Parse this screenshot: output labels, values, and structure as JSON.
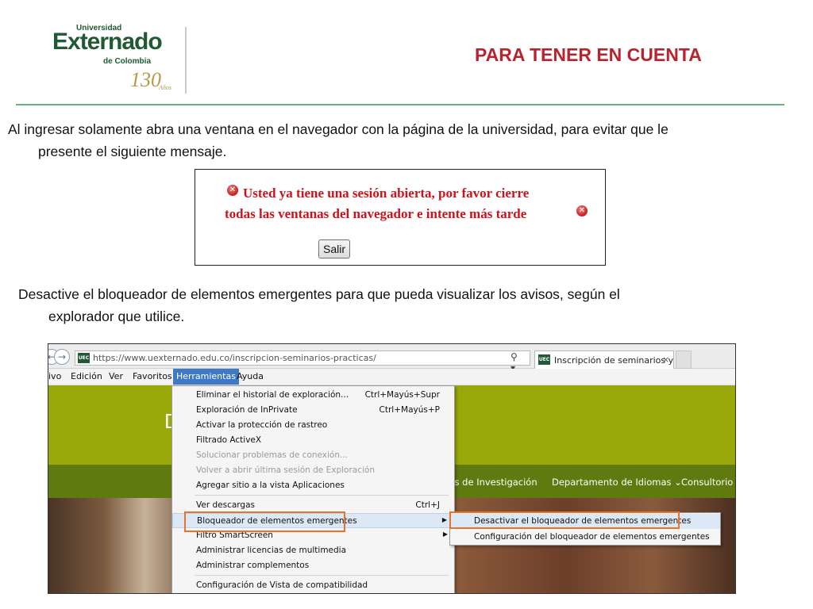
{
  "header": {
    "logo": {
      "universidad": "Universidad",
      "externado": "Externado",
      "de_colombia": "de Colombia",
      "anniversary": "130",
      "anos": "Años"
    },
    "title": "PARA TENER EN CUENTA"
  },
  "paragraph1": {
    "line1": "Al ingresar solamente abra una ventana en el navegador con la página de la universidad, para evitar que le",
    "line2": "presente el siguiente mensaje."
  },
  "warning_dialog": {
    "line1": "Usted ya tiene una sesión abierta, por favor cierre",
    "line2": "todas las ventanas del navegador e intente más tarde",
    "icon": "error-icon",
    "button_label": "Salir"
  },
  "paragraph2": {
    "line1": "Desactive el bloqueador de elementos emergentes para que pueda visualizar los avisos, según el",
    "line2": "explorador que utilice."
  },
  "browser": {
    "favicon_text": "UEC",
    "url": "https://www.uexternado.edu.co/inscripcion-seminarios-practicas/",
    "address_icons": "⚲ ▾ 🔒 ↻",
    "tab_title": "Inscripción de seminarios y ...",
    "tab_close": "×",
    "menu": [
      "ivo",
      "Edición",
      "Ver",
      "Favoritos",
      "Herramientas",
      "Ayuda"
    ],
    "banner_letter": "D",
    "site_nav": [
      "ros de Investigación",
      "Departamento de Idiomas ⌄",
      "Consultorio"
    ],
    "tools_menu": [
      {
        "label": "Eliminar el historial de exploración...",
        "shortcut": "Ctrl+Mayús+Supr",
        "disabled": false
      },
      {
        "label": "Exploración de InPrivate",
        "shortcut": "Ctrl+Mayús+P",
        "disabled": false
      },
      {
        "label": "Activar la protección de rastreo",
        "shortcut": "",
        "disabled": false
      },
      {
        "label": "Filtrado ActiveX",
        "shortcut": "",
        "disabled": false
      },
      {
        "label": "Solucionar problemas de conexión...",
        "shortcut": "",
        "disabled": true
      },
      {
        "label": "Volver a abrir última sesión de Exploración",
        "shortcut": "",
        "disabled": true
      },
      {
        "label": "Agregar sitio a la vista Aplicaciones",
        "shortcut": "",
        "disabled": false
      },
      {
        "label": "Ver descargas",
        "shortcut": "Ctrl+J",
        "disabled": false
      },
      {
        "label": "Bloqueador de elementos emergentes",
        "shortcut": "",
        "disabled": false,
        "submenu": true
      },
      {
        "label": "Filtro SmartScreen",
        "shortcut": "",
        "disabled": false,
        "submenu": true
      },
      {
        "label": "Administrar licencias de multimedia",
        "shortcut": "",
        "disabled": false
      },
      {
        "label": "Administrar complementos",
        "shortcut": "",
        "disabled": false
      },
      {
        "label": "Configuración de Vista de compatibilidad",
        "shortcut": "",
        "disabled": false
      }
    ],
    "popup_submenu": [
      "Desactivar el bloqueador de elementos emergentes",
      "Configuración del bloqueador de elementos emergentes"
    ]
  },
  "colors": {
    "title_red": "#b8232e",
    "rule_green": "#63b383",
    "logo_green": "#1f5a32",
    "warning_red": "#d0101a",
    "highlight_orange": "#e8742a",
    "menu_selected_blue": "#3d79c4",
    "site_banner_olive": "#9aa909"
  }
}
